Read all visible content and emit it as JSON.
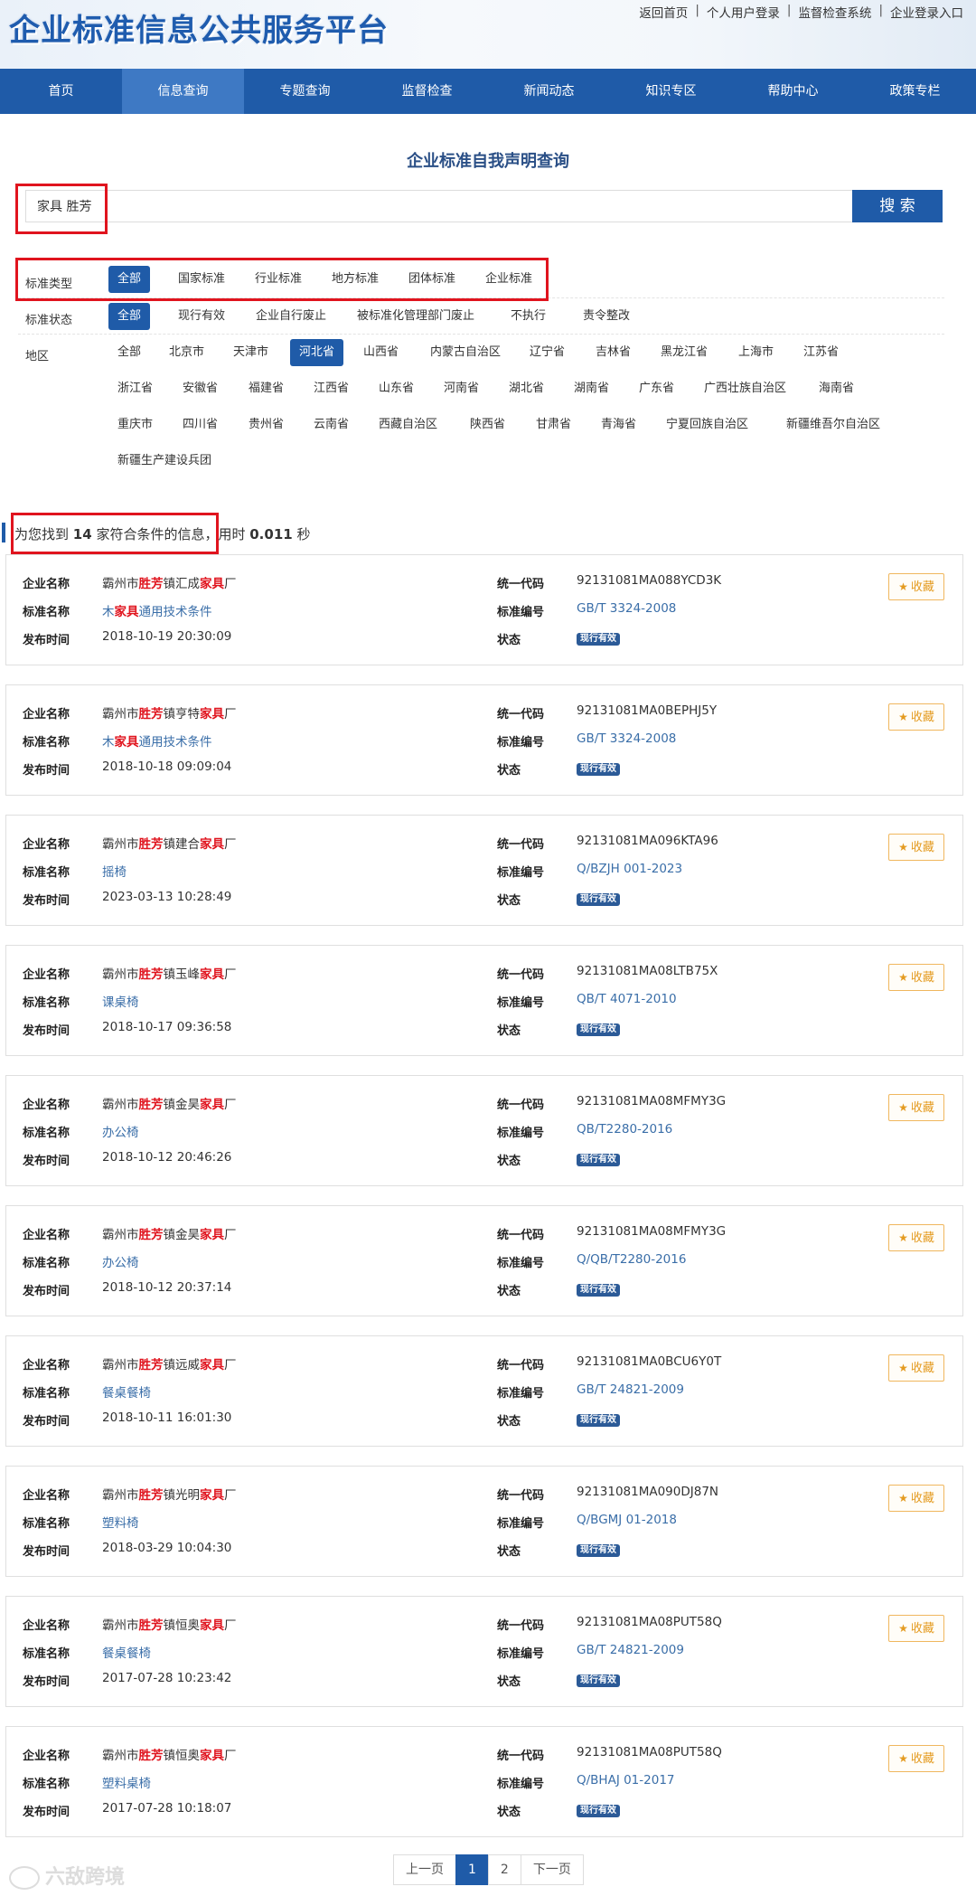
{
  "site": {
    "logo": "企业标准信息公共服务平台",
    "toplinks": [
      "返回首页",
      "个人用户登录",
      "监督检查系统",
      "企业登录入口"
    ]
  },
  "nav": [
    "首页",
    "信息查询",
    "专题查询",
    "监督检查",
    "新闻动态",
    "知识专区",
    "帮助中心",
    "政策专栏"
  ],
  "search": {
    "title": "企业标准自我声明查询",
    "value": "家具 胜芳",
    "button": "搜 索"
  },
  "filters": {
    "type": {
      "label": "标准类型",
      "options": [
        "全部",
        "国家标准",
        "行业标准",
        "地方标准",
        "团体标准",
        "企业标准"
      ]
    },
    "status": {
      "label": "标准状态",
      "options": [
        "全部",
        "现行有效",
        "企业自行废止",
        "被标准化管理部门废止",
        "不执行",
        "责令整改"
      ]
    },
    "region": {
      "label": "地区",
      "rows": [
        [
          "全部",
          "北京市",
          "天津市",
          "河北省",
          "山西省",
          "内蒙古自治区",
          "辽宁省",
          "吉林省",
          "黑龙江省",
          "上海市",
          "江苏省"
        ],
        [
          "浙江省",
          "安徽省",
          "福建省",
          "江西省",
          "山东省",
          "河南省",
          "湖北省",
          "湖南省",
          "广东省",
          "广西壮族自治区",
          "海南省"
        ],
        [
          "重庆市",
          "四川省",
          "贵州省",
          "云南省",
          "西藏自治区",
          "陕西省",
          "甘肃省",
          "青海省",
          "宁夏回族自治区",
          "新疆维吾尔自治区"
        ],
        [
          "新疆生产建设兵团"
        ]
      ]
    }
  },
  "summary": {
    "prefix": "为您找到",
    "count": "14",
    "middle": "家符合条件的信息，用时",
    "time": "0.011",
    "suffix": "秒"
  },
  "labels": {
    "company": "企业名称",
    "standard": "标准名称",
    "date": "发布时间",
    "code": "统一代码",
    "number": "标准编号",
    "status": "状态",
    "fav": "收藏"
  },
  "results": [
    {
      "company": [
        "霸州市",
        "胜芳",
        "镇汇成",
        "家具",
        "厂"
      ],
      "standard": [
        "木",
        "家具",
        "通用技术条件"
      ],
      "date": "2018-10-19 20:30:09",
      "code": "92131081MA088YCD3K",
      "number": "GB/T 3324-2008",
      "status": "现行有效"
    },
    {
      "company": [
        "霸州市",
        "胜芳",
        "镇亨特",
        "家具",
        "厂"
      ],
      "standard": [
        "木",
        "家具",
        "通用技术条件"
      ],
      "date": "2018-10-18 09:09:04",
      "code": "92131081MA0BEPHJ5Y",
      "number": "GB/T 3324-2008",
      "status": "现行有效"
    },
    {
      "company": [
        "霸州市",
        "胜芳",
        "镇建合",
        "家具",
        "厂"
      ],
      "standard": [
        "",
        "",
        "摇椅"
      ],
      "date": "2023-03-13 10:28:49",
      "code": "92131081MA096KTA96",
      "number": "Q/BZJH 001-2023",
      "status": "现行有效"
    },
    {
      "company": [
        "霸州市",
        "胜芳",
        "镇玉峰",
        "家具",
        "厂"
      ],
      "standard": [
        "",
        "",
        "课桌椅"
      ],
      "date": "2018-10-17 09:36:58",
      "code": "92131081MA08LTB75X",
      "number": "QB/T 4071-2010",
      "status": "现行有效"
    },
    {
      "company": [
        "霸州市",
        "胜芳",
        "镇金昊",
        "家具",
        "厂"
      ],
      "standard": [
        "",
        "",
        "办公椅"
      ],
      "date": "2018-10-12 20:46:26",
      "code": "92131081MA08MFMY3G",
      "number": "QB/T2280-2016",
      "status": "现行有效"
    },
    {
      "company": [
        "霸州市",
        "胜芳",
        "镇金昊",
        "家具",
        "厂"
      ],
      "standard": [
        "",
        "",
        "办公椅"
      ],
      "date": "2018-10-12 20:37:14",
      "code": "92131081MA08MFMY3G",
      "number": "Q/QB/T2280-2016",
      "status": "现行有效"
    },
    {
      "company": [
        "霸州市",
        "胜芳",
        "镇远威",
        "家具",
        "厂"
      ],
      "standard": [
        "",
        "",
        "餐桌餐椅"
      ],
      "date": "2018-10-11 16:01:30",
      "code": "92131081MA0BCU6Y0T",
      "number": "GB/T 24821-2009",
      "status": "现行有效"
    },
    {
      "company": [
        "霸州市",
        "胜芳",
        "镇光明",
        "家具",
        "厂"
      ],
      "standard": [
        "",
        "",
        "塑料椅"
      ],
      "date": "2018-03-29 10:04:30",
      "code": "92131081MA090DJ87N",
      "number": "Q/BGMJ 01-2018",
      "status": "现行有效"
    },
    {
      "company": [
        "霸州市",
        "胜芳",
        "镇恒奥",
        "家具",
        "厂"
      ],
      "standard": [
        "",
        "",
        "餐桌餐椅"
      ],
      "date": "2017-07-28 10:23:42",
      "code": "92131081MA08PUT58Q",
      "number": "GB/T 24821-2009",
      "status": "现行有效"
    },
    {
      "company": [
        "霸州市",
        "胜芳",
        "镇恒奥",
        "家具",
        "厂"
      ],
      "standard": [
        "",
        "",
        "塑料桌椅"
      ],
      "date": "2017-07-28 10:18:07",
      "code": "92131081MA08PUT58Q",
      "number": "Q/BHAJ 01-2017",
      "status": "现行有效"
    }
  ],
  "pagination": [
    "上一页",
    "1",
    "2",
    "下一页"
  ],
  "watermark": "六敌跨境",
  "colors": {
    "primary": "#1f5ba8",
    "highlight": "#e0141e",
    "annotation": "#e0141e",
    "fav": "#e49b20"
  }
}
